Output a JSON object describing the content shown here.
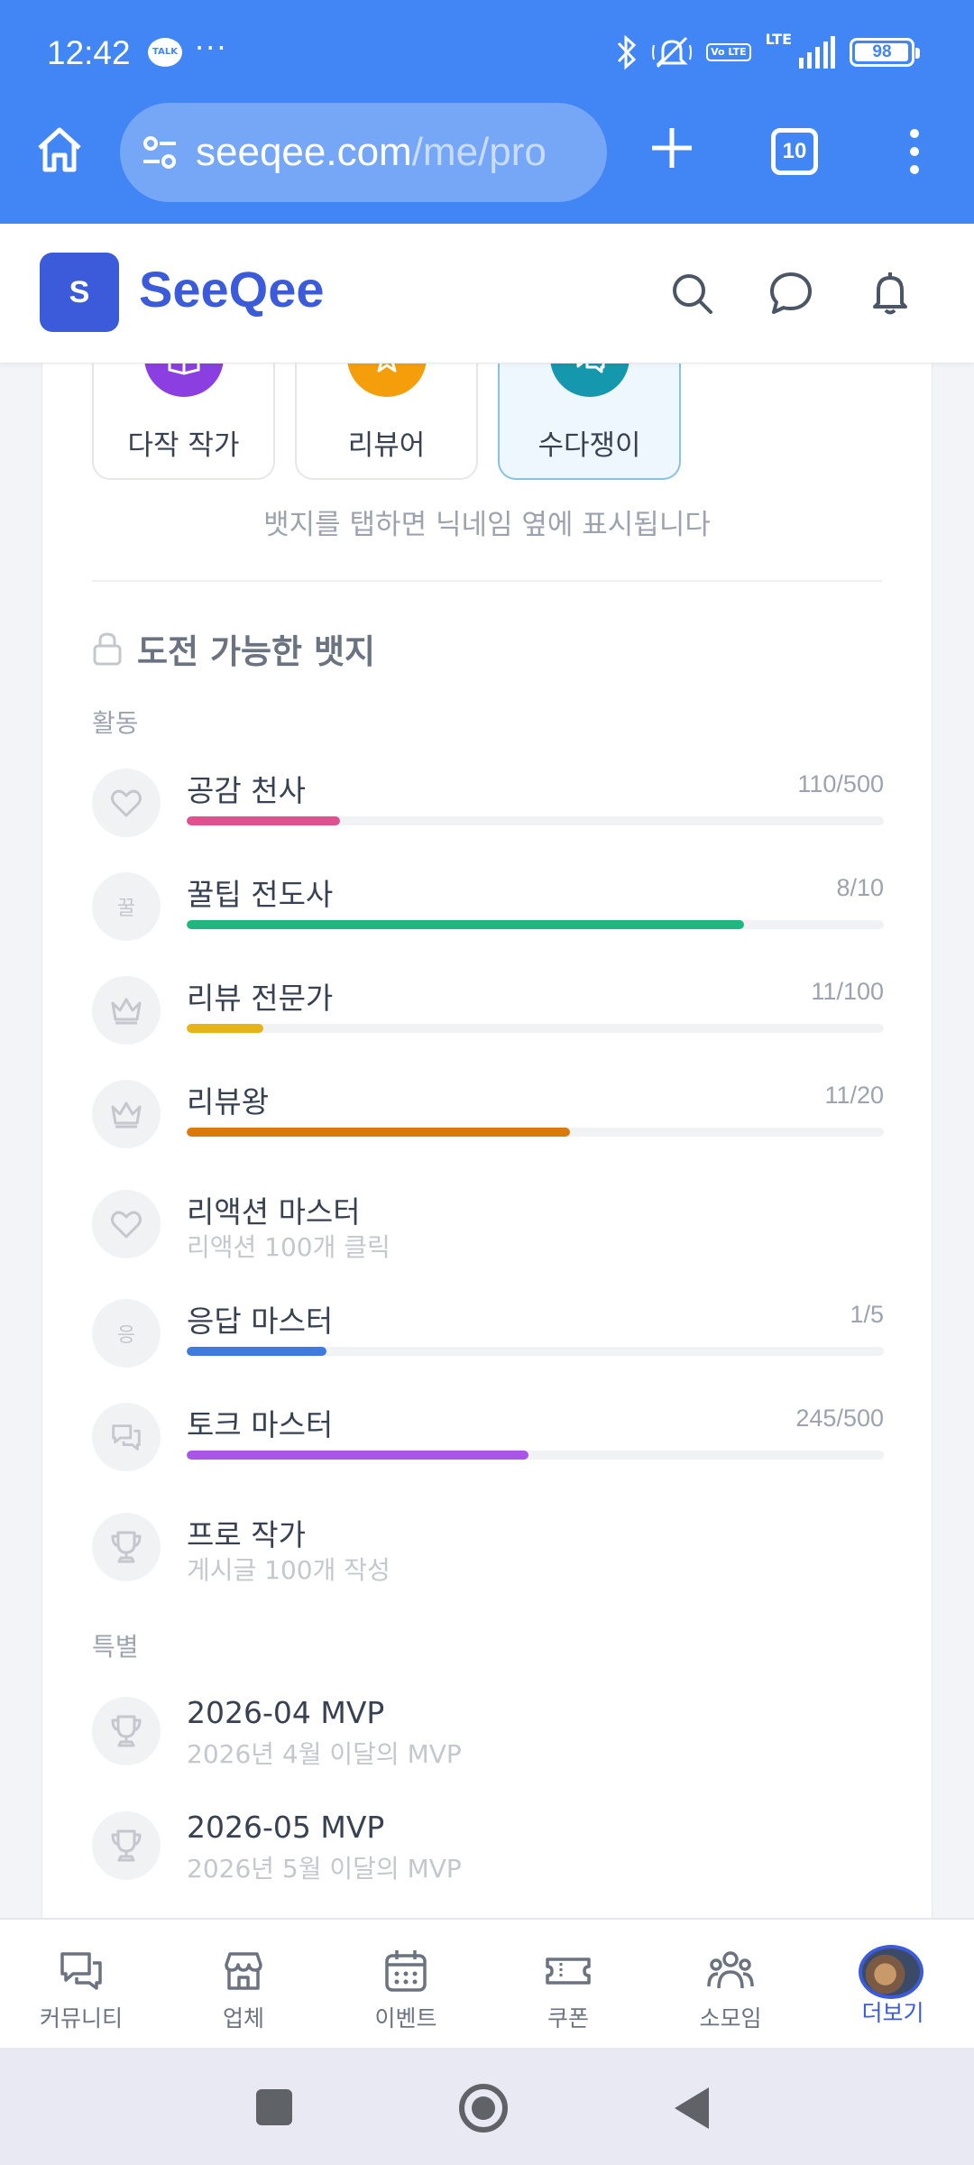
{
  "status_bar": {
    "time": "12:42",
    "talk_badge": "TALK",
    "more": "···",
    "volte": "Vo LTE",
    "lte": "LTE",
    "battery": "98"
  },
  "browser": {
    "url_host": "seeqee.com",
    "url_path": "/me/pro",
    "tab_count": "10",
    "accent": "#4285f4"
  },
  "header": {
    "logo_letter": "S",
    "brand": "SeeQee",
    "brand_color": "#3b5bdb",
    "icons": [
      "search-icon",
      "chat-icon",
      "bell-icon"
    ]
  },
  "earned_badges": [
    {
      "label": "다작 작가",
      "color": "#8b3fe0",
      "icon": "book-icon"
    },
    {
      "label": "리뷰어",
      "color": "#f59e0b",
      "icon": "star-icon"
    },
    {
      "label": "수다쟁이",
      "color": "#1597ad",
      "icon": "chat-bubbles-icon",
      "selected": true
    }
  ],
  "hint": "뱃지를 탭하면 닉네임 옆에 표시됩니다",
  "challenge": {
    "title": "도전 가능한 뱃지",
    "groups": [
      {
        "label": "활동",
        "items": [
          {
            "name": "공감 천사",
            "count": "110/500",
            "progress": 0.22,
            "color": "#e0508f",
            "icon": "heart-icon"
          },
          {
            "name": "꿀팁 전도사",
            "count": "8/10",
            "progress": 0.8,
            "color": "#1fb67f",
            "icon_text": "꿀"
          },
          {
            "name": "리뷰 전문가",
            "count": "11/100",
            "progress": 0.11,
            "color": "#e6b418",
            "icon": "crown-icon"
          },
          {
            "name": "리뷰왕",
            "count": "11/20",
            "progress": 0.55,
            "color": "#d97a0c",
            "icon": "crown-icon"
          },
          {
            "name": "리액션 마스터",
            "desc": "리액션 100개 클릭",
            "icon": "heart-icon"
          },
          {
            "name": "응답 마스터",
            "count": "1/5",
            "progress": 0.2,
            "color": "#3d7be0",
            "icon_text": "응"
          },
          {
            "name": "토크 마스터",
            "count": "245/500",
            "progress": 0.49,
            "color": "#a855e8",
            "icon": "chat-bubbles-icon"
          },
          {
            "name": "프로 작가",
            "desc": "게시글 100개 작성",
            "icon": "trophy-icon"
          }
        ]
      },
      {
        "label": "특별",
        "items": [
          {
            "name": "2026-04 MVP",
            "desc": "2026년 4월 이달의 MVP",
            "icon": "trophy-icon"
          },
          {
            "name": "2026-05 MVP",
            "desc": "2026년 5월 이달의 MVP",
            "icon": "trophy-icon"
          }
        ]
      }
    ]
  },
  "bottom_nav": [
    {
      "label": "커뮤니티",
      "icon": "community-icon"
    },
    {
      "label": "업체",
      "icon": "store-icon"
    },
    {
      "label": "이벤트",
      "icon": "calendar-icon"
    },
    {
      "label": "쿠폰",
      "icon": "ticket-icon"
    },
    {
      "label": "소모임",
      "icon": "group-icon"
    },
    {
      "label": "더보기",
      "icon": "avatar",
      "active": true
    }
  ]
}
